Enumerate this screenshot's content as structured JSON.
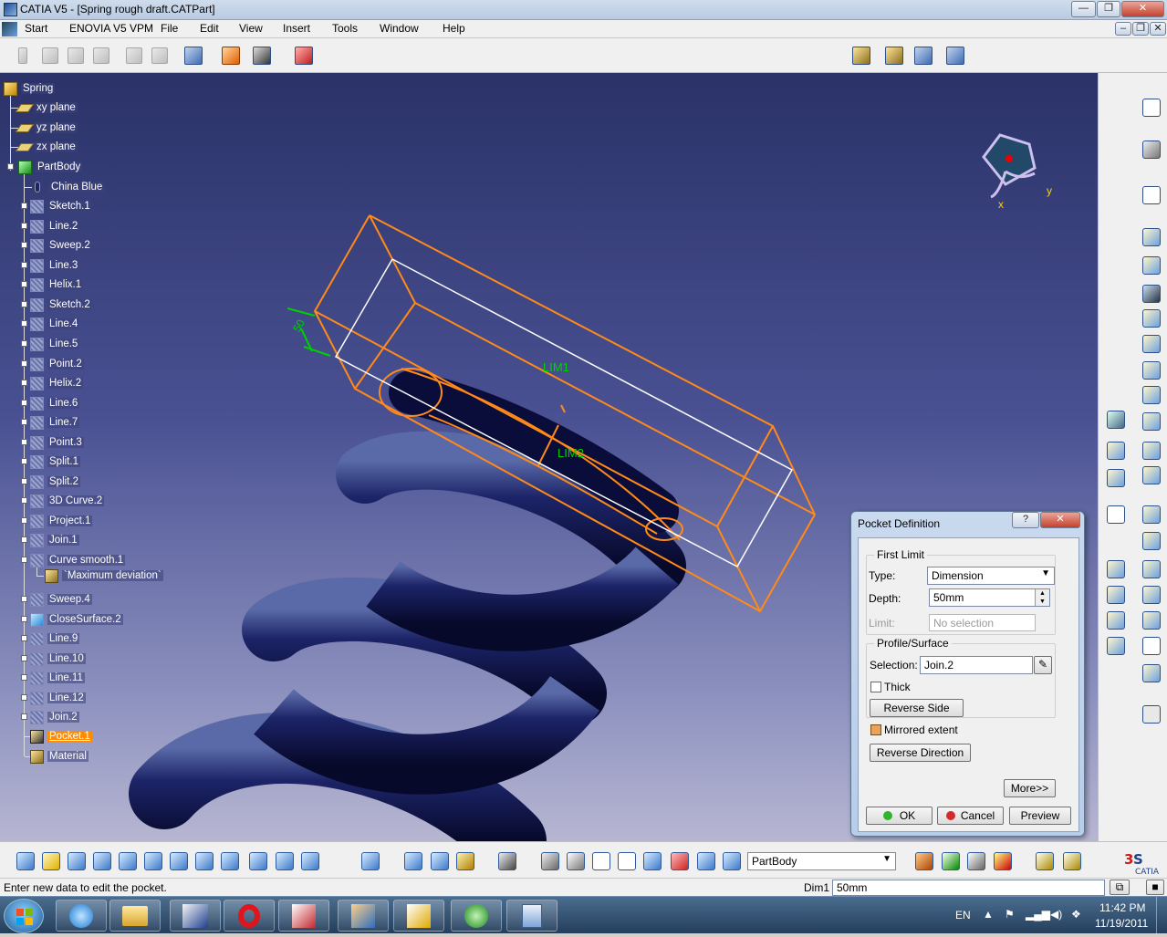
{
  "window": {
    "title": "CATIA V5 - [Spring rough draft.CATPart]"
  },
  "menubar": {
    "items": [
      {
        "label": "Start"
      },
      {
        "label": "ENOVIA V5 VPM"
      },
      {
        "label": "File"
      },
      {
        "label": "Edit"
      },
      {
        "label": "View"
      },
      {
        "label": "Insert"
      },
      {
        "label": "Tools"
      },
      {
        "label": "Window"
      },
      {
        "label": "Help"
      }
    ]
  },
  "tree": {
    "root": "Spring",
    "planes": [
      "xy plane",
      "yz plane",
      "zx plane"
    ],
    "partbody": "PartBody",
    "material_color": "China Blue",
    "items": [
      "Sketch.1",
      "Line.2",
      "Sweep.2",
      "Line.3",
      "Helix.1",
      "Sketch.2",
      "Line.4",
      "Line.5",
      "Point.2",
      "Helix.2",
      "Line.6",
      "Line.7",
      "Point.3",
      "Split.1",
      "Split.2",
      "3D Curve.2",
      "Project.1",
      "Join.1",
      "Curve smooth.1"
    ],
    "sub_item": "`Maximum deviation`",
    "items2": [
      "Sweep.4",
      "CloseSurface.2",
      "Line.9",
      "Line.10",
      "Line.11",
      "Line.12",
      "Join.2"
    ],
    "selected": "Pocket.1",
    "last": "Material"
  },
  "viewport": {
    "lim1": "LIM1",
    "lim2": "LIM2",
    "dim": "50",
    "compass_x": "x",
    "compass_y": "y"
  },
  "dialog": {
    "title": "Pocket Definition",
    "help": "?",
    "close": "✕",
    "first_limit": "First Limit",
    "type_label": "Type:",
    "type_value": "Dimension",
    "depth_label": "Depth:",
    "depth_value": "50mm",
    "limit_label": "Limit:",
    "limit_value": "No selection",
    "profile_surface": "Profile/Surface",
    "selection_label": "Selection:",
    "selection_value": "Join.2",
    "thick_label": "Thick",
    "reverse_side": "Reverse Side",
    "mirrored_extent": "Mirrored extent",
    "reverse_direction": "Reverse Direction",
    "more": "More>>",
    "ok": "OK",
    "cancel": "Cancel",
    "preview": "Preview"
  },
  "bottom_toolbar": {
    "combo_value": "PartBody"
  },
  "statusbar": {
    "message": "Enter new data to edit the pocket.",
    "dim_label": "Dim1",
    "dim_value": "50mm"
  },
  "taskbar": {
    "lang": "EN",
    "time": "11:42 PM",
    "date": "11/19/2011"
  }
}
